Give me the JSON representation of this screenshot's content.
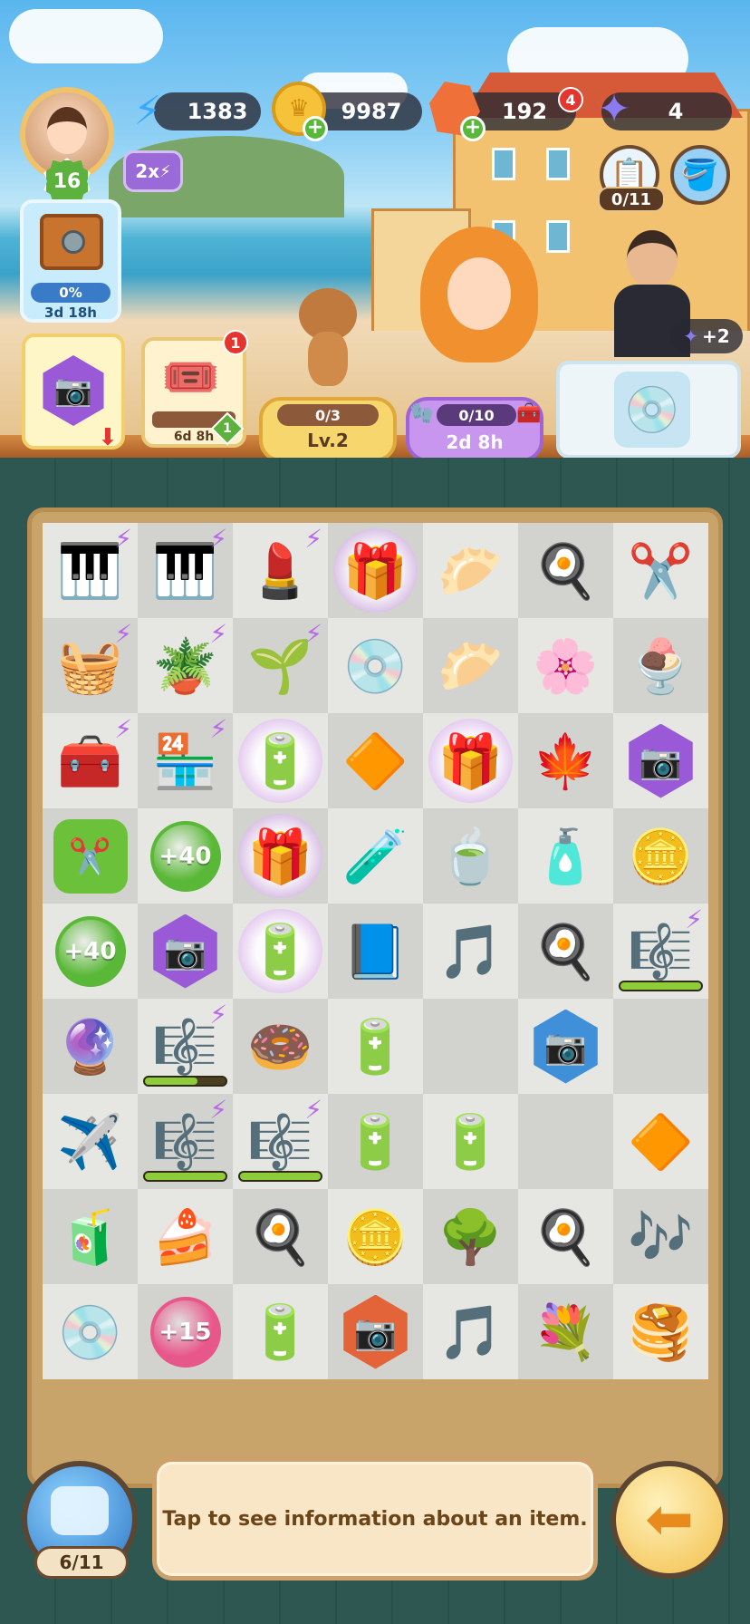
{
  "player": {
    "level": "16",
    "boost_label": "2x"
  },
  "currencies": {
    "energy": {
      "value": "1383",
      "icon": "lightning-icon",
      "color": "#3aa8ff"
    },
    "coins": {
      "value": "9987",
      "icon": "coin-icon",
      "color": "#f5c23a"
    },
    "gems": {
      "value": "192",
      "icon": "gem-icon",
      "color": "#f0703a",
      "badge": "4"
    },
    "stars": {
      "value": "4",
      "icon": "star-icon",
      "color": "#8a7cf0"
    }
  },
  "quick_buttons": {
    "tasks_progress": "0/11"
  },
  "vault": {
    "progress": "0%",
    "timer": "3d 18h"
  },
  "orders": {
    "ticket_timer": "6d 8h",
    "ticket_badge": "1",
    "ticket_sub_badge": "1",
    "dog_progress": "0/3",
    "dog_level": "Lv.2",
    "girl_progress": "0/10",
    "girl_timer": "2d 8h",
    "butler_bonus": "+2"
  },
  "board": {
    "cells": [
      {
        "icon": "🎹",
        "bolt": true
      },
      {
        "icon": "🎹",
        "bolt": true
      },
      {
        "icon": "💄",
        "bolt": true
      },
      {
        "icon": "🎁",
        "glow": true
      },
      {
        "icon": "🥟"
      },
      {
        "icon": "🍳"
      },
      {
        "icon": "✂️"
      },
      {
        "icon": "🧺",
        "bolt": true
      },
      {
        "icon": "🪴",
        "bolt": true
      },
      {
        "icon": "🌱",
        "bolt": true
      },
      {
        "icon": "💿"
      },
      {
        "icon": "🥟"
      },
      {
        "icon": "🌸"
      },
      {
        "icon": "🍨"
      },
      {
        "icon": "🧰",
        "bolt": true
      },
      {
        "icon": "🏪",
        "bolt": true
      },
      {
        "icon": "🔋",
        "glow": true
      },
      {
        "icon": "🔶"
      },
      {
        "icon": "🎁",
        "glow": true
      },
      {
        "icon": "🍁"
      },
      {
        "icon": "📷",
        "hex": "#9a5ad8"
      },
      {
        "icon": "✂️",
        "tile": "#6bc23a"
      },
      {
        "disc": "+40",
        "disc_color": "#5ab838"
      },
      {
        "icon": "🎁",
        "glow": true
      },
      {
        "icon": "🧪"
      },
      {
        "icon": "🍵"
      },
      {
        "icon": "🧴"
      },
      {
        "icon": "🪙"
      },
      {
        "disc": "+40",
        "disc_color": "#5ab838"
      },
      {
        "icon": "📷",
        "hex": "#9a5ad8"
      },
      {
        "icon": "🔋",
        "glow": true
      },
      {
        "icon": "📘"
      },
      {
        "icon": "🎵"
      },
      {
        "icon": "🍳"
      },
      {
        "icon": "🎼",
        "bolt": true,
        "progress": 1.0
      },
      {
        "icon": "🔮"
      },
      {
        "icon": "🎼",
        "bolt": true,
        "progress": 0.65
      },
      {
        "icon": "🍩"
      },
      {
        "icon": "🔋"
      },
      {
        "icon": ""
      },
      {
        "icon": "📷",
        "hex": "#3f8fd9"
      },
      {
        "icon": ""
      },
      {
        "icon": "✈️"
      },
      {
        "icon": "🎼",
        "bolt": true,
        "progress": 1.0
      },
      {
        "icon": "🎼",
        "bolt": true,
        "progress": 1.0
      },
      {
        "icon": "🔋"
      },
      {
        "icon": "🔋"
      },
      {
        "icon": ""
      },
      {
        "icon": "🔶"
      },
      {
        "icon": "🧃"
      },
      {
        "icon": "🍰"
      },
      {
        "icon": "🍳"
      },
      {
        "icon": "🪙"
      },
      {
        "icon": "🌳"
      },
      {
        "icon": "🍳"
      },
      {
        "icon": "🎶"
      },
      {
        "icon": "💿"
      },
      {
        "disc": "+15",
        "disc_color": "#e8578a"
      },
      {
        "icon": "🔋"
      },
      {
        "icon": "📷",
        "hex": "#e4643a"
      },
      {
        "icon": "🎵"
      },
      {
        "icon": "💐"
      },
      {
        "icon": "🥞"
      }
    ]
  },
  "footer": {
    "info_text": "Tap to see information about an item.",
    "inventory_count": "6/11"
  }
}
